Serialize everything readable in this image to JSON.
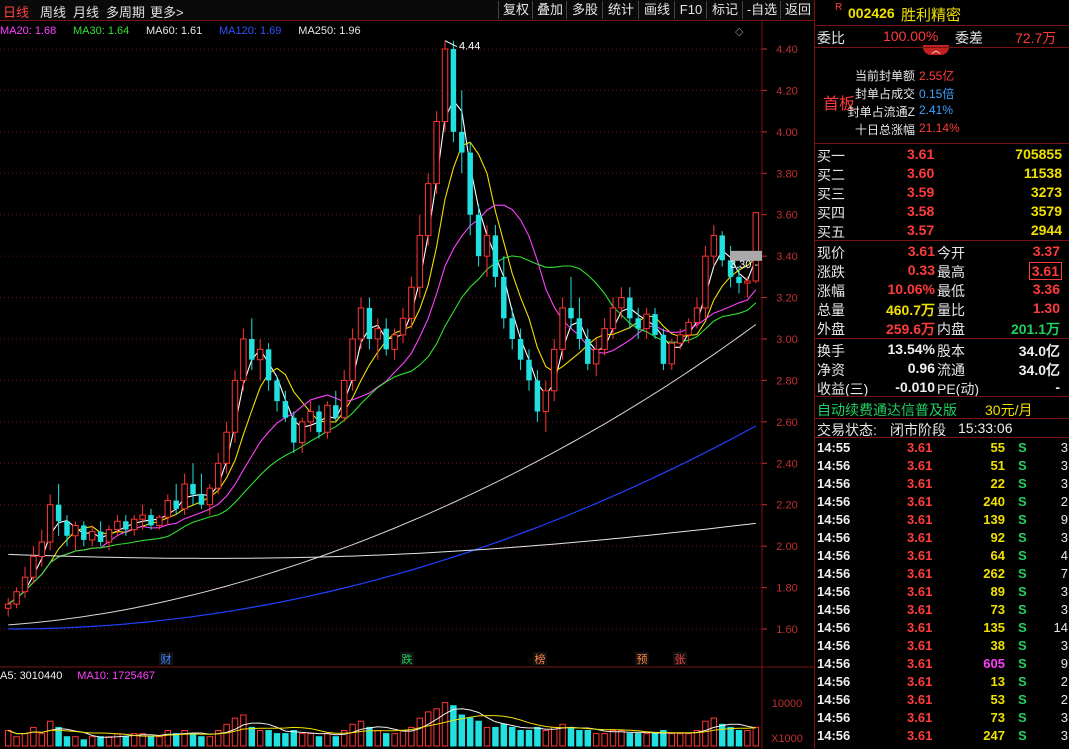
{
  "toolbar": {
    "left": [
      "日线",
      "周线",
      "月线",
      "多周期",
      "更多>"
    ],
    "right": [
      "复权",
      "叠加",
      "多股",
      "统计",
      "画线",
      "F10",
      "标记",
      "-自选",
      "返回"
    ]
  },
  "indicators": {
    "ma_labels": [
      {
        "text": "MA20: 1.68",
        "color": "#ff40ff"
      },
      {
        "text": "MA30: 1.64",
        "color": "#30e030"
      },
      {
        "text": "MA60: 1.61",
        "color": "#e6e6e6"
      },
      {
        "text": "MA120: 1.69",
        "color": "#3050ff"
      },
      {
        "text": "MA250: 1.96",
        "color": "#e6e6e6"
      }
    ],
    "vol_labels": [
      {
        "text": "A5: 3010440",
        "color": "#f0f0f0"
      },
      {
        "text": "MA10: 1725467",
        "color": "#ff40ff"
      }
    ]
  },
  "chart_data": {
    "type": "candlestick",
    "y_ticks": [
      "4.40",
      "4.20",
      "4.00",
      "3.80",
      "3.60",
      "3.40",
      "3.20",
      "3.00",
      "2.80",
      "2.60",
      "2.40",
      "2.20",
      "2.00",
      "1.80",
      "1.60"
    ],
    "y_range": [
      1.5,
      4.5
    ],
    "high_label": "4.44",
    "price_tag": "3.30",
    "vol_tick": "10000",
    "vol_unit": "X1000",
    "event_markers": [
      {
        "text": "财",
        "color": "#4080ff"
      },
      {
        "text": "跌",
        "color": "#20d060"
      },
      {
        "text": "榜",
        "color": "#ff8040"
      },
      {
        "text": "预",
        "color": "#ff8040"
      },
      {
        "text": "张",
        "color": "#ff4040"
      }
    ],
    "candles": [
      [
        1.7,
        1.75,
        1.66,
        1.72
      ],
      [
        1.72,
        1.8,
        1.7,
        1.78
      ],
      [
        1.78,
        1.9,
        1.75,
        1.85
      ],
      [
        1.85,
        2.0,
        1.82,
        1.95
      ],
      [
        1.95,
        2.08,
        1.9,
        2.02
      ],
      [
        2.02,
        2.25,
        1.98,
        2.2
      ],
      [
        2.2,
        2.3,
        2.05,
        2.12
      ],
      [
        2.12,
        2.15,
        2.0,
        2.05
      ],
      [
        2.05,
        2.12,
        1.98,
        2.1
      ],
      [
        2.1,
        2.12,
        2.0,
        2.03
      ],
      [
        2.03,
        2.1,
        2.0,
        2.07
      ],
      [
        2.07,
        2.12,
        2.0,
        2.02
      ],
      [
        2.02,
        2.1,
        1.98,
        2.08
      ],
      [
        2.08,
        2.15,
        2.05,
        2.12
      ],
      [
        2.12,
        2.15,
        2.05,
        2.08
      ],
      [
        2.08,
        2.15,
        2.05,
        2.13
      ],
      [
        2.13,
        2.2,
        2.08,
        2.15
      ],
      [
        2.15,
        2.18,
        2.08,
        2.1
      ],
      [
        2.1,
        2.15,
        2.08,
        2.14
      ],
      [
        2.14,
        2.25,
        2.1,
        2.22
      ],
      [
        2.22,
        2.3,
        2.15,
        2.18
      ],
      [
        2.18,
        2.35,
        2.15,
        2.3
      ],
      [
        2.3,
        2.4,
        2.2,
        2.25
      ],
      [
        2.25,
        2.35,
        2.18,
        2.2
      ],
      [
        2.2,
        2.3,
        2.15,
        2.28
      ],
      [
        2.28,
        2.45,
        2.25,
        2.4
      ],
      [
        2.4,
        2.6,
        2.35,
        2.55
      ],
      [
        2.55,
        2.85,
        2.5,
        2.8
      ],
      [
        2.8,
        3.05,
        2.75,
        3.0
      ],
      [
        3.0,
        3.1,
        2.85,
        2.9
      ],
      [
        2.9,
        3.0,
        2.8,
        2.95
      ],
      [
        2.95,
        2.98,
        2.75,
        2.8
      ],
      [
        2.8,
        2.82,
        2.65,
        2.7
      ],
      [
        2.7,
        2.75,
        2.6,
        2.62
      ],
      [
        2.62,
        2.65,
        2.45,
        2.5
      ],
      [
        2.5,
        2.62,
        2.45,
        2.6
      ],
      [
        2.6,
        2.7,
        2.55,
        2.65
      ],
      [
        2.65,
        2.68,
        2.52,
        2.55
      ],
      [
        2.55,
        2.7,
        2.52,
        2.68
      ],
      [
        2.68,
        2.75,
        2.6,
        2.62
      ],
      [
        2.62,
        2.85,
        2.6,
        2.8
      ],
      [
        2.8,
        3.05,
        2.75,
        3.0
      ],
      [
        3.0,
        3.2,
        2.95,
        3.15
      ],
      [
        3.15,
        3.2,
        2.95,
        3.0
      ],
      [
        3.0,
        3.1,
        2.9,
        3.05
      ],
      [
        3.05,
        3.1,
        2.92,
        2.95
      ],
      [
        2.95,
        3.05,
        2.9,
        3.02
      ],
      [
        3.02,
        3.15,
        2.98,
        3.1
      ],
      [
        3.1,
        3.3,
        3.05,
        3.25
      ],
      [
        3.25,
        3.6,
        3.2,
        3.5
      ],
      [
        3.5,
        3.8,
        3.45,
        3.75
      ],
      [
        3.75,
        4.1,
        3.7,
        4.05
      ],
      [
        4.05,
        4.44,
        4.0,
        4.4
      ],
      [
        4.4,
        4.44,
        3.95,
        4.0
      ],
      [
        4.0,
        4.2,
        3.8,
        3.9
      ],
      [
        3.9,
        3.95,
        3.5,
        3.6
      ],
      [
        3.6,
        3.65,
        3.35,
        3.4
      ],
      [
        3.4,
        3.55,
        3.3,
        3.5
      ],
      [
        3.5,
        3.55,
        3.25,
        3.3
      ],
      [
        3.3,
        3.4,
        3.05,
        3.1
      ],
      [
        3.1,
        3.15,
        2.95,
        3.0
      ],
      [
        3.0,
        3.05,
        2.85,
        2.9
      ],
      [
        2.9,
        2.95,
        2.75,
        2.8
      ],
      [
        2.8,
        2.85,
        2.6,
        2.65
      ],
      [
        2.65,
        2.8,
        2.55,
        2.75
      ],
      [
        2.75,
        3.0,
        2.7,
        2.95
      ],
      [
        2.95,
        3.2,
        2.9,
        3.15
      ],
      [
        3.15,
        3.3,
        3.05,
        3.1
      ],
      [
        3.1,
        3.2,
        2.95,
        3.0
      ],
      [
        3.0,
        3.05,
        2.85,
        2.88
      ],
      [
        2.88,
        3.0,
        2.82,
        2.95
      ],
      [
        2.95,
        3.1,
        2.92,
        3.05
      ],
      [
        3.05,
        3.2,
        3.0,
        3.15
      ],
      [
        3.15,
        3.25,
        3.1,
        3.2
      ],
      [
        3.2,
        3.25,
        3.05,
        3.1
      ],
      [
        3.1,
        3.15,
        3.0,
        3.05
      ],
      [
        3.05,
        3.15,
        3.0,
        3.12
      ],
      [
        3.12,
        3.15,
        3.0,
        3.02
      ],
      [
        3.02,
        3.05,
        2.85,
        2.88
      ],
      [
        2.88,
        3.0,
        2.85,
        2.98
      ],
      [
        2.98,
        3.05,
        2.95,
        3.02
      ],
      [
        3.02,
        3.1,
        2.98,
        3.08
      ],
      [
        3.08,
        3.2,
        3.05,
        3.15
      ],
      [
        3.15,
        3.45,
        3.1,
        3.4
      ],
      [
        3.4,
        3.55,
        3.35,
        3.5
      ],
      [
        3.5,
        3.52,
        3.35,
        3.38
      ],
      [
        3.38,
        3.45,
        3.25,
        3.3
      ],
      [
        3.3,
        3.35,
        3.22,
        3.27
      ],
      [
        3.27,
        3.3,
        3.2,
        3.28
      ],
      [
        3.28,
        3.61,
        3.27,
        3.61
      ]
    ],
    "volumes": [
      5,
      3,
      4,
      6,
      4,
      8,
      6,
      3,
      3,
      2,
      3,
      3,
      3,
      4,
      3,
      4,
      4,
      3,
      3,
      5,
      4,
      5,
      4,
      3,
      3,
      5,
      7,
      9,
      10,
      6,
      5,
      5,
      4,
      4,
      5,
      4,
      4,
      3,
      4,
      3,
      5,
      7,
      8,
      6,
      5,
      4,
      4,
      5,
      6,
      9,
      11,
      12,
      14,
      13,
      10,
      9,
      8,
      6,
      6,
      7,
      6,
      5,
      5,
      6,
      5,
      6,
      7,
      6,
      5,
      5,
      4,
      4,
      5,
      5,
      4,
      4,
      4,
      4,
      5,
      4,
      4,
      4,
      5,
      8,
      9,
      7,
      6,
      5,
      5,
      6
    ]
  },
  "stock": {
    "tag": "R",
    "code": "002426",
    "name": "胜利精密"
  },
  "committee": {
    "ratio_label": "委比",
    "ratio_value": "100.00%",
    "diff_label": "委差",
    "diff_value": "72.7万"
  },
  "limit_info": {
    "board": "首板",
    "rows": [
      {
        "label": "当前封单额",
        "value": "2.55亿"
      },
      {
        "label": "封单占成交",
        "value": "0.15倍"
      },
      {
        "label": "封单占流通Z",
        "value": "2.41%"
      },
      {
        "label": "十日总涨幅",
        "value": "21.14%"
      }
    ]
  },
  "bids": [
    {
      "label": "买一",
      "price": "3.61",
      "vol": "705855"
    },
    {
      "label": "买二",
      "price": "3.60",
      "vol": "11538"
    },
    {
      "label": "买三",
      "price": "3.59",
      "vol": "3273"
    },
    {
      "label": "买四",
      "price": "3.58",
      "vol": "3579"
    },
    {
      "label": "买五",
      "price": "3.57",
      "vol": "2944"
    }
  ],
  "quote": [
    {
      "l1": "现价",
      "v1": "3.61",
      "c1": "red",
      "l2": "今开",
      "v2": "3.37",
      "c2": "red"
    },
    {
      "l1": "涨跌",
      "v1": "0.33",
      "c1": "red",
      "l2": "最高",
      "v2": "3.61",
      "c2": "red"
    },
    {
      "l1": "涨幅",
      "v1": "10.06%",
      "c1": "red",
      "l2": "最低",
      "v2": "3.36",
      "c2": "red"
    },
    {
      "l1": "总量",
      "v1": "460.7万",
      "c1": "yel",
      "l2": "量比",
      "v2": "1.30",
      "c2": "red"
    },
    {
      "l1": "外盘",
      "v1": "259.6万",
      "c1": "red",
      "l2": "内盘",
      "v2": "201.1万",
      "c2": "grn"
    }
  ],
  "fundamentals": [
    {
      "l1": "换手",
      "v1": "13.54%",
      "l2": "股本",
      "v2": "34.0亿"
    },
    {
      "l1": "净资",
      "v1": "0.96",
      "l2": "流通",
      "v2": "34.0亿"
    },
    {
      "l1": "收益(三)",
      "v1": "-0.010",
      "l2": "PE(动)",
      "v2": "-"
    }
  ],
  "promo": {
    "text": "自动续费通达信普及版",
    "price": "30元/月"
  },
  "trade_status": {
    "label": "交易状态:",
    "value": "闭市阶段",
    "time": "15:33:06"
  },
  "ticks": [
    {
      "t": "14:55",
      "p": "3.61",
      "v": "55",
      "s": "S",
      "n": "3"
    },
    {
      "t": "14:56",
      "p": "3.61",
      "v": "51",
      "s": "S",
      "n": "3"
    },
    {
      "t": "14:56",
      "p": "3.61",
      "v": "22",
      "s": "S",
      "n": "3"
    },
    {
      "t": "14:56",
      "p": "3.61",
      "v": "240",
      "s": "S",
      "n": "2"
    },
    {
      "t": "14:56",
      "p": "3.61",
      "v": "139",
      "s": "S",
      "n": "9"
    },
    {
      "t": "14:56",
      "p": "3.61",
      "v": "92",
      "s": "S",
      "n": "3"
    },
    {
      "t": "14:56",
      "p": "3.61",
      "v": "64",
      "s": "S",
      "n": "4"
    },
    {
      "t": "14:56",
      "p": "3.61",
      "v": "262",
      "s": "S",
      "n": "7"
    },
    {
      "t": "14:56",
      "p": "3.61",
      "v": "89",
      "s": "S",
      "n": "3"
    },
    {
      "t": "14:56",
      "p": "3.61",
      "v": "73",
      "s": "S",
      "n": "3"
    },
    {
      "t": "14:56",
      "p": "3.61",
      "v": "135",
      "s": "S",
      "n": "14"
    },
    {
      "t": "14:56",
      "p": "3.61",
      "v": "38",
      "s": "S",
      "n": "3"
    },
    {
      "t": "14:56",
      "p": "3.61",
      "v": "605",
      "s": "S",
      "n": "9"
    },
    {
      "t": "14:56",
      "p": "3.61",
      "v": "13",
      "s": "S",
      "n": "2"
    },
    {
      "t": "14:56",
      "p": "3.61",
      "v": "53",
      "s": "S",
      "n": "2"
    },
    {
      "t": "14:56",
      "p": "3.61",
      "v": "73",
      "s": "S",
      "n": "3"
    },
    {
      "t": "14:56",
      "p": "3.61",
      "v": "247",
      "s": "S",
      "n": "3"
    }
  ]
}
